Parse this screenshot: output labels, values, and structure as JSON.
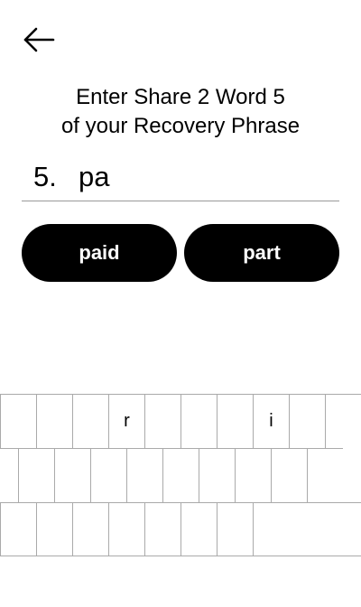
{
  "header": {
    "back_icon": "arrow-left-icon"
  },
  "prompt": {
    "line1": "Enter Share 2 Word 5",
    "line2": "of your Recovery Phrase"
  },
  "word_entry": {
    "index_label": "5.",
    "value": "pa"
  },
  "suggestions": [
    {
      "label": "paid"
    },
    {
      "label": "part"
    }
  ],
  "keyboard": {
    "row1": [
      "",
      "",
      "",
      "r",
      "",
      "",
      "",
      "i",
      "",
      ""
    ],
    "row2": [
      "",
      "",
      "",
      "",
      "",
      "",
      "",
      "",
      "",
      ""
    ],
    "row3": [
      "",
      "",
      "",
      "",
      "",
      "",
      "",
      ""
    ]
  }
}
